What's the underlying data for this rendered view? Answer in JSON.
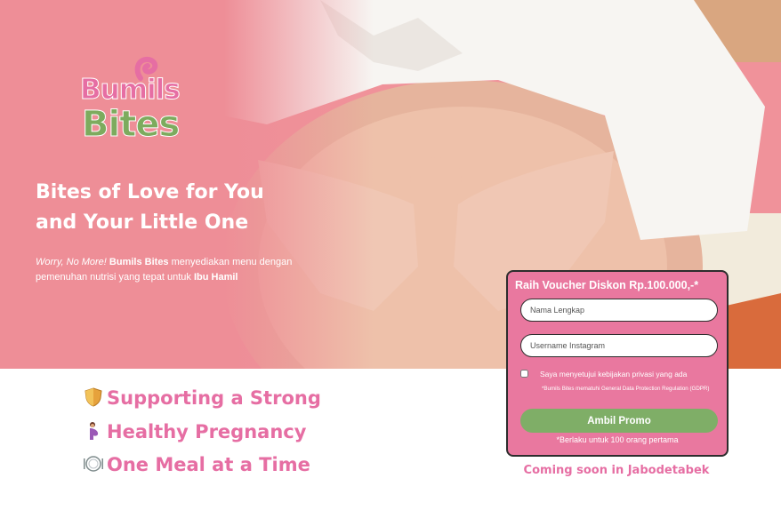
{
  "brand": {
    "line1": "Bumils",
    "line2": "Bites"
  },
  "hero": {
    "title_line1": "Bites of Love for You",
    "title_line2": "and Your Little One",
    "desc_italic": "Worry, No More!",
    "desc_brand": "Bumils Bites",
    "desc_mid": " menyediakan menu dengan pemenuhan nutrisi yang tepat untuk ",
    "desc_end": "Ibu Hamil"
  },
  "voucher": {
    "title": "Raih Voucher Diskon Rp.100.000,-*",
    "name_placeholder": "Nama Lengkap",
    "ig_placeholder": "Username Instagram",
    "consent": "Saya menyetujui kebijakan privasi yang ada",
    "gdpr": "*Bumils Bites mematuhi General Data Protection Regulation (GDPR)",
    "button": "Ambil Promo",
    "note": "*Berlaku untuk 100 orang pertama"
  },
  "coming": "Coming soon in Jabodetabek",
  "taglines": [
    {
      "icon": "shield-icon",
      "text": "Supporting a Strong"
    },
    {
      "icon": "pregnant-woman-icon",
      "text": "Healthy Pregnancy"
    },
    {
      "icon": "plate-icon",
      "text": "One Meal at a Time"
    }
  ],
  "colors": {
    "pink": "#e66ea3",
    "green": "#7fae67",
    "hero_bg": "#f0929a",
    "form_bg": "#e9789f"
  }
}
